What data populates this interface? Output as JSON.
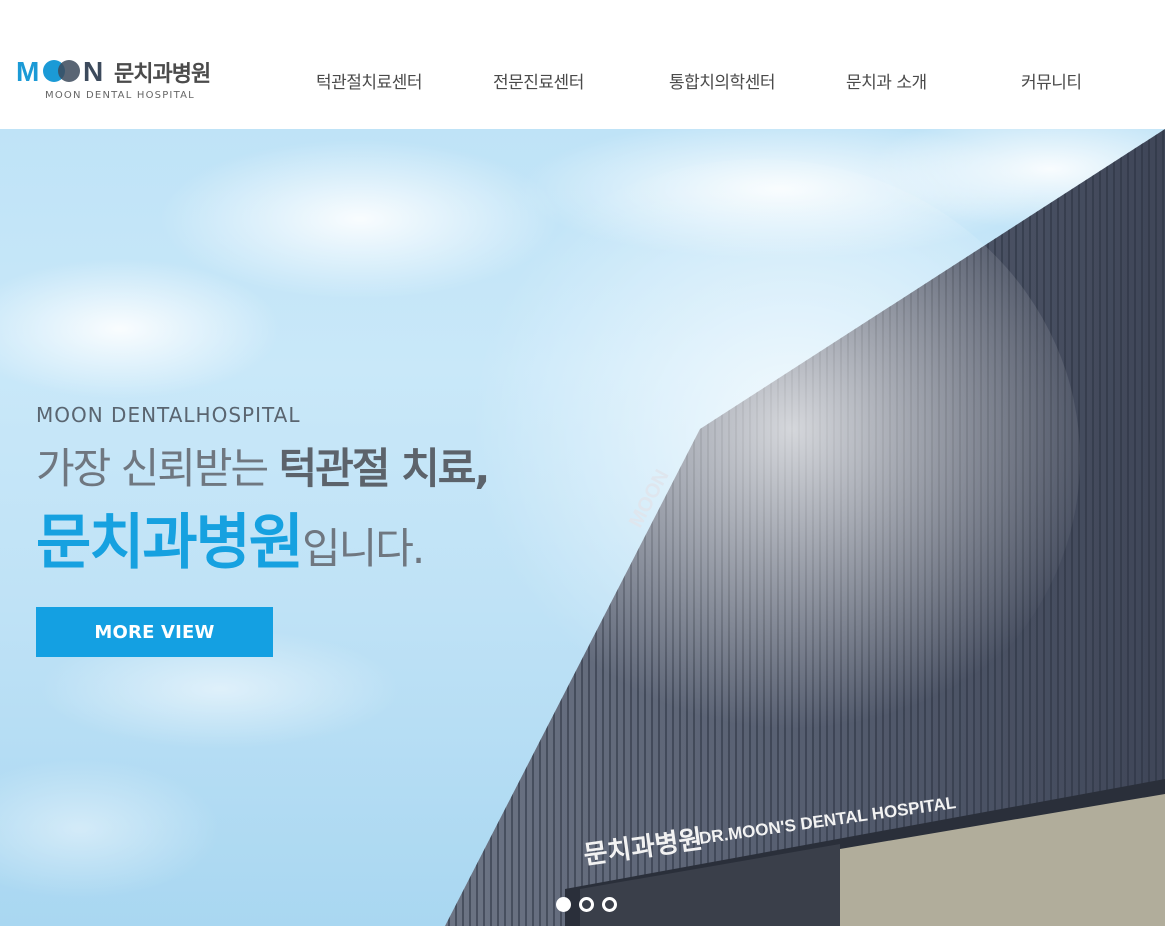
{
  "header": {
    "logo": {
      "mark_text": "MOON",
      "korean_name": "문치과병원",
      "english_name": "MOON DENTAL HOSPITAL"
    },
    "nav": [
      {
        "label": "턱관절치료센터"
      },
      {
        "label": "전문진료센터"
      },
      {
        "label": "통합치의학센터"
      },
      {
        "label": "문치과 소개"
      },
      {
        "label": "커뮤니티"
      }
    ]
  },
  "hero": {
    "subtitle": "MOON DENTALHOSPITAL",
    "line1_normal": "가장 신뢰받는 ",
    "line1_bold": "턱관절 치료,",
    "line2_accent": "문치과병원",
    "line2_rest": "입니다.",
    "button_label": "MORE VIEW",
    "building_sign_ko": "문치과병원",
    "building_sign_en": "DR.MOON'S DENTAL HOSPITAL",
    "building_top_sign": "MOON",
    "slides": {
      "count": 3,
      "active_index": 0
    }
  },
  "colors": {
    "accent": "#14a0e2",
    "logo_blue": "#1b9ad6",
    "logo_dark": "#3c4a5c",
    "text_gray": "#6f7780"
  }
}
